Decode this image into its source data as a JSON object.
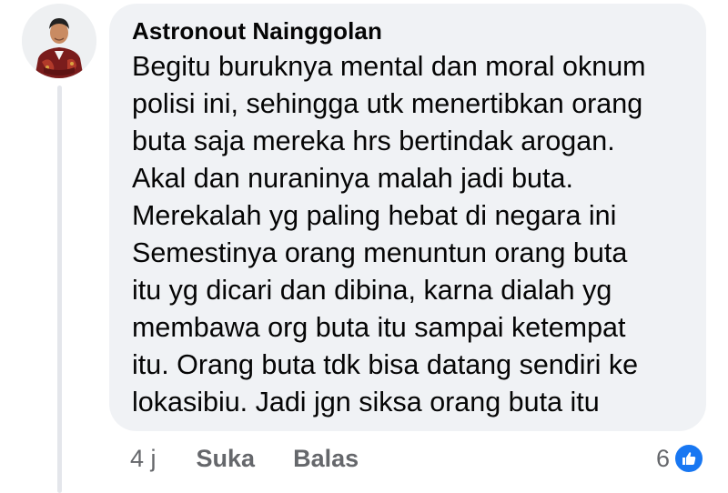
{
  "comment": {
    "author": "Astronout Nainggolan",
    "lines": [
      "Begitu buruknya mental dan moral oknum",
      "polisi ini, sehingga utk menertibkan orang",
      "buta saja mereka hrs bertindak arogan.",
      "Akal dan nuraninya malah jadi buta.",
      "Merekalah yg paling hebat di negara ini",
      "Semestinya orang menuntun orang buta",
      "itu yg dicari dan dibina, karna dialah yg",
      "membawa org buta itu sampai ketempat",
      "itu. Orang buta tdk bisa datang sendiri ke",
      "lokasibiu. Jadi jgn siksa orang buta itu"
    ],
    "time": "4 j",
    "like_label": "Suka",
    "reply_label": "Balas",
    "reaction_count": "6",
    "reaction_icon": "thumbs-up-icon",
    "avatar_icon": "profile-photo"
  },
  "colors": {
    "bubble": "#f0f2f5",
    "text": "#050505",
    "muted": "#65676b",
    "like_blue": "#1877f2",
    "thread_line": "#e4e6eb"
  }
}
